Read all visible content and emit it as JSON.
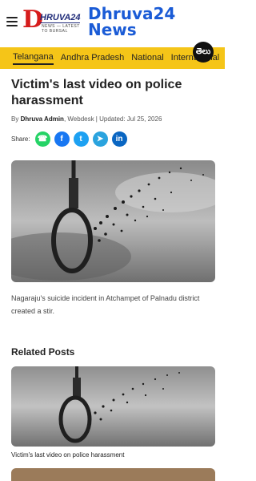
{
  "header": {
    "logo_mark": "D",
    "logo_text": "HRUVA24",
    "logo_tagline": "NEWS — LATEST TO BURSAL",
    "brand_line1": "Dhruva24",
    "brand_line2": "News"
  },
  "nav": {
    "items": [
      "Telangana",
      "Andhra Pradesh",
      "National",
      "International"
    ],
    "active_index": 0,
    "language_button": "తెలు"
  },
  "article": {
    "title": "Victim's last video on police harassment",
    "meta_prefix": "By ",
    "author": "Dhruva Admin",
    "meta_suffix": ", Webdesk | Updated: Jul 25, 2026",
    "share_label": "Share:",
    "share_buttons": [
      {
        "name": "whatsapp",
        "glyph": "☎",
        "color": "#25d366"
      },
      {
        "name": "facebook",
        "glyph": "f",
        "color": "#1877f2"
      },
      {
        "name": "twitter",
        "glyph": "t",
        "color": "#1da1f2"
      },
      {
        "name": "telegram",
        "glyph": "➤",
        "color": "#2aa3de"
      },
      {
        "name": "linkedin",
        "glyph": "in",
        "color": "#0a66c2"
      }
    ],
    "caption": "Nagaraju's suicide incident in Atchampet of Palnadu district created a stir."
  },
  "related": {
    "heading": "Related Posts",
    "posts": [
      {
        "title": "Victim's last video on police harassment"
      }
    ]
  }
}
